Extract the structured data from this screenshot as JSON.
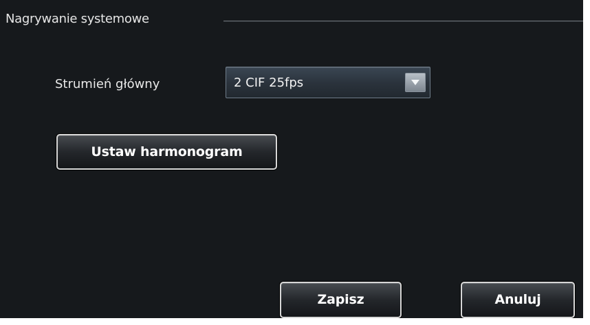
{
  "group": {
    "title": "Nagrywanie systemowe"
  },
  "stream": {
    "label": "Strumień główny",
    "selected": "2 CIF 25fps"
  },
  "icons": {
    "dropdown": "chevron-down-icon"
  },
  "buttons": {
    "schedule": "Ustaw harmonogram",
    "save": "Zapisz",
    "cancel": "Anuluj"
  },
  "colors": {
    "background": "#16191c",
    "text": "#e9e9e9",
    "button_border": "#d7d7d7",
    "select_background": "#2a323b"
  }
}
